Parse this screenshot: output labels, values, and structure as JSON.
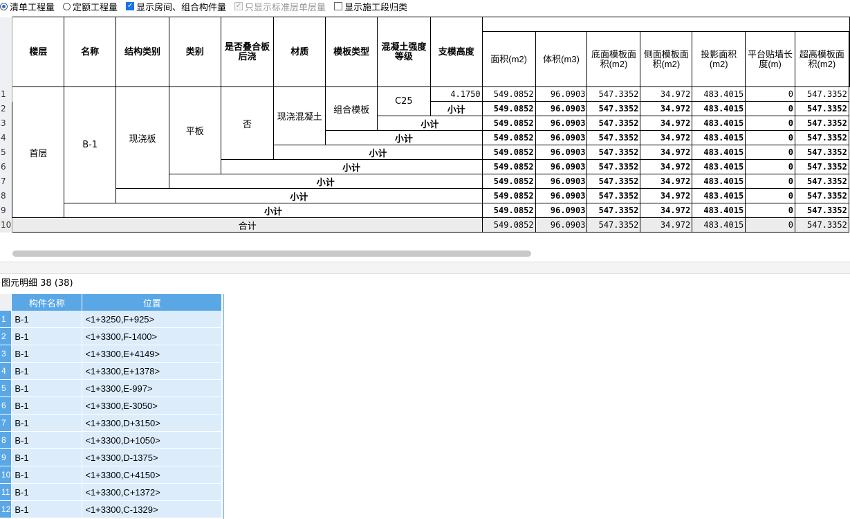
{
  "options": [
    {
      "type": "radio",
      "checked": true,
      "label": "清单工程量"
    },
    {
      "type": "radio",
      "checked": false,
      "label": "定额工程量"
    },
    {
      "type": "checkbox",
      "checked": true,
      "label": "显示房间、组合构件量"
    },
    {
      "type": "checkbox",
      "checked": true,
      "disabled": true,
      "label": "只显示标准层单层量"
    },
    {
      "type": "checkbox",
      "checked": false,
      "label": "显示施工段归类"
    }
  ],
  "table": {
    "headers": [
      "楼层",
      "名称",
      "结构类别",
      "类别",
      "是否叠合板后浇",
      "材质",
      "模板类型",
      "混凝土强度等级",
      "支模高度",
      "面积(m2)",
      "体积(m3)",
      "底面模板面积(m2)",
      "侧面模板面积(m2)",
      "投影面积(m2)",
      "平台贴墙长度(m)",
      "超高模板面积(m2)"
    ],
    "floor": "首层",
    "name": "B-1",
    "struct": "现浇板",
    "category": "平板",
    "laminated": "否",
    "material": "现浇混凝土",
    "formwork": "组合模板",
    "grade": "C25",
    "height": "4.1750",
    "subtotal": "小计",
    "total": "合计",
    "values": [
      "549.0852",
      "96.0903",
      "547.3352",
      "34.972",
      "483.4015",
      "0",
      "547.3352"
    ],
    "row_numbers": [
      "1",
      "2",
      "3",
      "4",
      "5",
      "6",
      "7",
      "8",
      "9",
      "10"
    ]
  },
  "detail": {
    "title": "图元明细",
    "count": "38 (38)",
    "col_name": "构件名称",
    "col_pos": "位置",
    "rows": [
      {
        "n": "1",
        "name": "B-1",
        "pos": "<1+3250,F+925>"
      },
      {
        "n": "2",
        "name": "B-1",
        "pos": "<1+3300,F-1400>"
      },
      {
        "n": "3",
        "name": "B-1",
        "pos": "<1+3300,E+4149>"
      },
      {
        "n": "4",
        "name": "B-1",
        "pos": "<1+3300,E+1378>"
      },
      {
        "n": "5",
        "name": "B-1",
        "pos": "<1+3300,E-997>"
      },
      {
        "n": "6",
        "name": "B-1",
        "pos": "<1+3300,E-3050>"
      },
      {
        "n": "7",
        "name": "B-1",
        "pos": "<1+3300,D+3150>"
      },
      {
        "n": "8",
        "name": "B-1",
        "pos": "<1+3300,D+1050>"
      },
      {
        "n": "9",
        "name": "B-1",
        "pos": "<1+3300,D-1375>"
      },
      {
        "n": "10",
        "name": "B-1",
        "pos": "<1+3300,C+4150>"
      },
      {
        "n": "11",
        "name": "B-1",
        "pos": "<1+3300,C+1372>"
      },
      {
        "n": "12",
        "name": "B-1",
        "pos": "<1+3300,C-1329>"
      }
    ]
  }
}
